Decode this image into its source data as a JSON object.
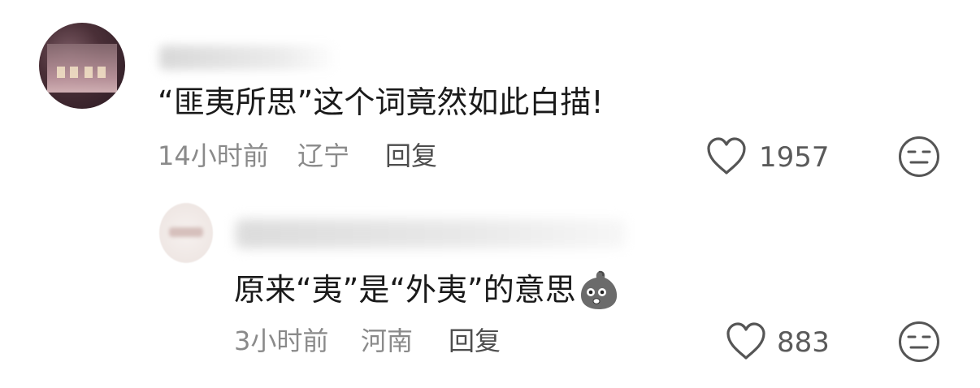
{
  "comments": [
    {
      "text": "“匪夷所思”这个词竟然如此白描!",
      "time": "14小时前",
      "location": "辽宁",
      "reply_label": "回复",
      "likes": "1957"
    },
    {
      "text": "原来“夷”是“外夷”的意思",
      "time": "3小时前",
      "location": "河南",
      "reply_label": "回复",
      "likes": "883"
    }
  ],
  "icons": {
    "like": "heart-outline-icon",
    "dislike": "unamused-face-icon",
    "emoji": "potato-face-emoji"
  },
  "colors": {
    "text": "#1a1a1a",
    "meta": "#8a8a8a",
    "reply": "#4d4d4d",
    "icon": "#555555"
  }
}
